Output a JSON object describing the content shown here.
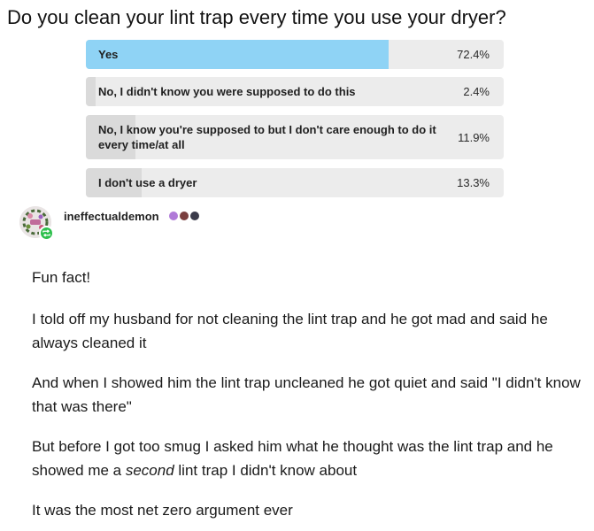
{
  "poll": {
    "question": "Do you clean your lint trap every time you use your dryer?",
    "options": [
      {
        "label": "Yes",
        "percent_text": "72.4%",
        "fraction": 0.724,
        "selected": true
      },
      {
        "label": "No, I didn't know you were supposed to do this",
        "percent_text": "2.4%",
        "fraction": 0.024,
        "selected": false
      },
      {
        "label": "No, I know you're supposed to but I don't care enough to do it every time/at all",
        "percent_text": "11.9%",
        "fraction": 0.119,
        "selected": false
      },
      {
        "label": "I don't use a dryer",
        "percent_text": "13.3%",
        "fraction": 0.133,
        "selected": false
      }
    ],
    "selected_color": "#8fd3f5"
  },
  "author": {
    "username": "ineffectualdemon",
    "avatar_icon": "avatar-image",
    "reblog_icon": "reblog-icon",
    "badges": [
      "#b07ad8",
      "#7a3f3f",
      "#3a3a4a"
    ]
  },
  "post": {
    "paragraphs": [
      "Fun fact!",
      "I told off my husband for not cleaning the lint trap and he got mad and said he always cleaned it",
      "And when I showed him the lint trap uncleaned he got quiet and said \"I didn't know that was there\"",
      "But before I got too smug I asked him what he thought was the lint trap and he showed me a second lint trap I didn't know about",
      "It was the most net zero argument ever"
    ]
  }
}
